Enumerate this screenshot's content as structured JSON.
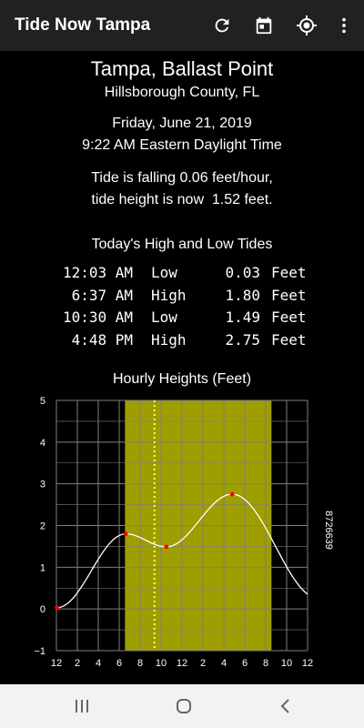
{
  "app_bar": {
    "title": "Tide Now Tampa",
    "actions": [
      {
        "name": "refresh-icon"
      },
      {
        "name": "calendar-icon"
      },
      {
        "name": "gps-location-icon"
      },
      {
        "name": "more-vert-icon"
      }
    ]
  },
  "location": {
    "name": "Tampa, Ballast Point",
    "county": "Hillsborough County, FL"
  },
  "datetime": {
    "date": "Friday, June 21, 2019",
    "time": "9:22 AM Eastern Daylight Time"
  },
  "status": {
    "rate": "Tide is falling 0.06 feet/hour,",
    "height": "tide height is now  1.52 feet."
  },
  "high_low": {
    "heading": "Today's High and Low Tides",
    "rows": [
      {
        "time": "12:03 AM",
        "type": "Low",
        "height": "0.03",
        "unit": "Feet"
      },
      {
        "time": "6:37 AM",
        "type": "High",
        "height": "1.80",
        "unit": "Feet"
      },
      {
        "time": "10:30 AM",
        "type": "Low",
        "height": "1.49",
        "unit": "Feet"
      },
      {
        "time": "4:48 PM",
        "type": "High",
        "height": "2.75",
        "unit": "Feet"
      }
    ]
  },
  "chart_data": {
    "type": "line",
    "title": "Hourly Heights (Feet)",
    "station_id": "8726639",
    "ylim": [
      -1,
      5
    ],
    "y_ticks": [
      "5",
      "4",
      "3",
      "2",
      "1",
      "0",
      "−1"
    ],
    "xlim": [
      0,
      24
    ],
    "x_ticks": [
      "12",
      "2",
      "4",
      "6",
      "8",
      "10",
      "12",
      "2",
      "4",
      "6",
      "8",
      "10",
      "12"
    ],
    "daylight_hours": [
      6.55,
      20.55
    ],
    "now_hour": 9.37,
    "extremes": [
      {
        "hour": 0.05,
        "height": 0.03
      },
      {
        "hour": 6.62,
        "height": 1.8
      },
      {
        "hour": 10.5,
        "height": 1.49
      },
      {
        "hour": 16.8,
        "height": 2.75
      }
    ],
    "end_point": {
      "hour": 24,
      "height": 0.25
    },
    "colors": {
      "grid": "#7f7f7f",
      "daylight": "#9e9e00",
      "curve": "#ffffff",
      "now": "#ffff66",
      "extreme": "#ff0000"
    }
  },
  "nav_bar": {
    "buttons": [
      {
        "name": "recents-icon"
      },
      {
        "name": "home-icon"
      },
      {
        "name": "back-icon"
      }
    ]
  }
}
